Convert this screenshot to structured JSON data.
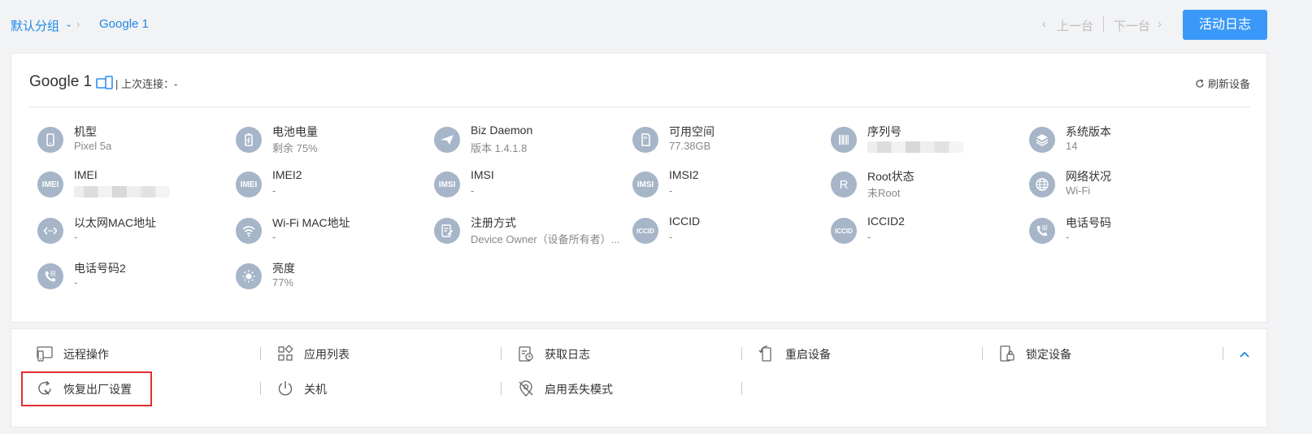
{
  "breadcrumb": {
    "group": "默认分组",
    "device": "Google 1"
  },
  "pager": {
    "prev": "上一台",
    "next": "下一台"
  },
  "activity_button": "活动日志",
  "device": {
    "name": "Google 1",
    "last_connection": "| 上次连接：-",
    "refresh": "刷新设备"
  },
  "info": [
    {
      "icon": "phone-icon",
      "label": "机型",
      "value": "Pixel 5a"
    },
    {
      "icon": "battery-icon",
      "label": "电池电量",
      "value": "剩余 75%"
    },
    {
      "icon": "send-icon",
      "label": "Biz Daemon",
      "value": "版本 1.4.1.8"
    },
    {
      "icon": "sd-card-icon",
      "label": "可用空间",
      "value": "77.38GB"
    },
    {
      "icon": "barcode-icon",
      "label": "序列号",
      "value": ""
    },
    {
      "icon": "layers-icon",
      "label": "系统版本",
      "value": "14"
    },
    {
      "icon": "imei-icon",
      "label": "IMEI",
      "value": ""
    },
    {
      "icon": "imei-icon",
      "label": "IMEI2",
      "value": "-"
    },
    {
      "icon": "imsi-icon",
      "label": "IMSI",
      "value": "-"
    },
    {
      "icon": "imsi-icon",
      "label": "IMSI2",
      "value": "-"
    },
    {
      "icon": "root-icon",
      "label": "Root状态",
      "value": "未Root"
    },
    {
      "icon": "globe-icon",
      "label": "网络状况",
      "value": "Wi-Fi"
    },
    {
      "icon": "ethernet-icon",
      "label": "以太网MAC地址",
      "value": "-"
    },
    {
      "icon": "wifi-icon",
      "label": "Wi-Fi MAC地址",
      "value": "-"
    },
    {
      "icon": "form-icon",
      "label": "注册方式",
      "value": "Device Owner（设备所有者）..."
    },
    {
      "icon": "iccid-icon",
      "label": "ICCID",
      "value": "-"
    },
    {
      "icon": "iccid-icon",
      "label": "ICCID2",
      "value": "-"
    },
    {
      "icon": "dialpad-phone-icon",
      "label": "电话号码",
      "value": "-"
    },
    {
      "icon": "dialpad-phone-icon",
      "label": "电话号码2",
      "value": "-"
    },
    {
      "icon": "brightness-icon",
      "label": "亮度",
      "value": "77%"
    }
  ],
  "icon_text": {
    "imei": "IMEI",
    "imsi": "IMSI",
    "iccid": "ICCID",
    "root": "R"
  },
  "actions": [
    {
      "icon": "remote-control-icon",
      "label": "远程操作"
    },
    {
      "icon": "app-list-icon",
      "label": "应用列表"
    },
    {
      "icon": "log-icon",
      "label": "获取日志"
    },
    {
      "icon": "restart-icon",
      "label": "重启设备"
    },
    {
      "icon": "lock-device-icon",
      "label": "锁定设备"
    },
    {
      "icon": "factory-reset-icon",
      "label": "恢复出厂设置"
    },
    {
      "icon": "power-icon",
      "label": "关机"
    },
    {
      "icon": "lost-mode-icon",
      "label": "启用丢失模式"
    }
  ],
  "colors": {
    "accent": "#3a99f8",
    "link": "#1e88e5",
    "icon_circle": "#a6b5c8",
    "highlight": "#e03030"
  }
}
